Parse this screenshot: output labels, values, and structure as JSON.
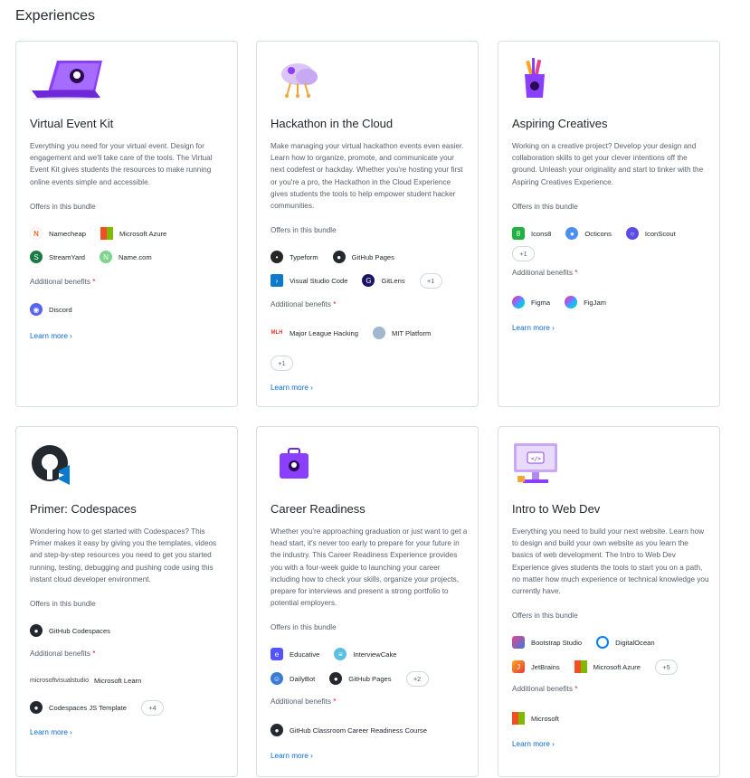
{
  "page_title": "Experiences",
  "cards": [
    {
      "title": "Virtual Event Kit",
      "description": "Everything you need for your virtual event. Design for engagement and we'll take care of the tools. The Virtual Event Kit gives students the resources to make running online events simple and accessible.",
      "offers_label": "Offers in this bundle",
      "offers": [
        "Namecheap",
        "Microsoft Azure",
        "StreamYard",
        "Name.com"
      ],
      "benefits_label": "Additional benefits",
      "benefits": [
        "Discord"
      ],
      "learn_more": "Learn more"
    },
    {
      "title": "Hackathon in the Cloud",
      "description": "Make managing your virtual hackathon events even easier. Learn how to organize, promote, and communicate your next codefest or hackday. Whether you're hosting your first or you're a pro, the Hackathon in the Cloud Experience gives students the tools to help empower student hacker communities.",
      "offers_label": "Offers in this bundle",
      "offers": [
        "Typeform",
        "GitHub Pages",
        "Visual Studio Code",
        "GitLens"
      ],
      "offers_more": "+1",
      "benefits_label": "Additional benefits",
      "benefits": [
        "Major League Hacking",
        "MIT Platform"
      ],
      "benefits_more": "+1",
      "learn_more": "Learn more"
    },
    {
      "title": "Aspiring Creatives",
      "description": "Working on a creative project? Develop your design and collaboration skills to get your clever intentions off the ground. Unleash your originality and start to tinker with the Aspiring Creatives Experience.",
      "offers_label": "Offers in this bundle",
      "offers": [
        "Icons8",
        "Octicons",
        "IconScout"
      ],
      "offers_more": "+1",
      "benefits_label": "Additional benefits",
      "benefits": [
        "Figma",
        "FigJam"
      ],
      "learn_more": "Learn more"
    },
    {
      "title": "Primer: Codespaces",
      "description": "Wondering how to get started with Codespaces? This Primer makes it easy by giving you the templates, videos and step-by-step resources you need to get you started running, testing, debugging and pushing code using this instant cloud developer environment.",
      "offers_label": "Offers in this bundle",
      "offers": [
        "GitHub Codespaces"
      ],
      "benefits_label": "Additional benefits",
      "benefits": [
        "Microsoft Learn",
        "Codespaces JS Template"
      ],
      "benefits_alt_text": "microsoftvisualstudio",
      "benefits_more": "+4",
      "learn_more": "Learn more"
    },
    {
      "title": "Career Readiness",
      "description": "Whether you're approaching graduation or just want to get a head start, it's never too early to prepare for your future in the industry. This Career Readiness Experience provides you with a four-week guide to launching your career including how to check your skills, organize your projects, prepare for interviews and present a strong portfolio to potential employers.",
      "offers_label": "Offers in this bundle",
      "offers": [
        "Educative",
        "InterviewCake",
        "DailyBot",
        "GitHub Pages"
      ],
      "offers_more": "+2",
      "benefits_label": "Additional benefits",
      "benefits": [
        "GitHub Classroom Career Readiness Course"
      ],
      "learn_more": "Learn more"
    },
    {
      "title": "Intro to Web Dev",
      "description": "Everything you need to build your next website. Learn how to design and build your own website as you learn the basics of web development. The Intro to Web Dev Experience gives students the tools to start you on a path, no matter how much experience or technical knowledge you currently have.",
      "offers_label": "Offers in this bundle",
      "offers": [
        "Bootstrap Studio",
        "DigitalOcean",
        "JetBrains",
        "Microsoft Azure"
      ],
      "offers_more": "+5",
      "benefits_label": "Additional benefits",
      "benefits": [
        "Microsoft"
      ],
      "learn_more": "Learn more"
    }
  ],
  "colors": {
    "link": "#0969da",
    "border": "#d8dee4",
    "muted_text": "#57606a",
    "required": "#cf222e",
    "purple_accent": "#8a3ffc"
  },
  "icons": {
    "cards": [
      "laptop-icon",
      "cloud-icon",
      "pencil-cup-icon",
      "github-vscode-icon",
      "briefcase-icon",
      "monitor-icon"
    ]
  }
}
